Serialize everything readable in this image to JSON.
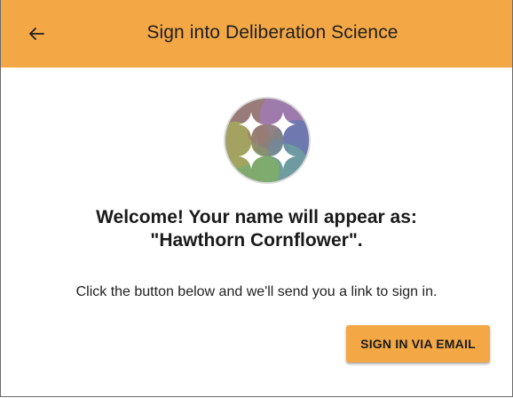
{
  "header": {
    "title": "Sign into Deliberation Science",
    "back_icon": "arrow-left-icon",
    "background_color": "#f3a845"
  },
  "avatar": {
    "icon": "identicon-avatar-icon"
  },
  "welcome": {
    "line1": "Welcome! Your name will appear as:",
    "line2": "\"Hawthorn Cornflower\"."
  },
  "instruction": "Click the button below and we'll send you a link to sign in.",
  "signin_button": {
    "label": "SIGN IN VIA EMAIL",
    "color": "#f3a845"
  }
}
